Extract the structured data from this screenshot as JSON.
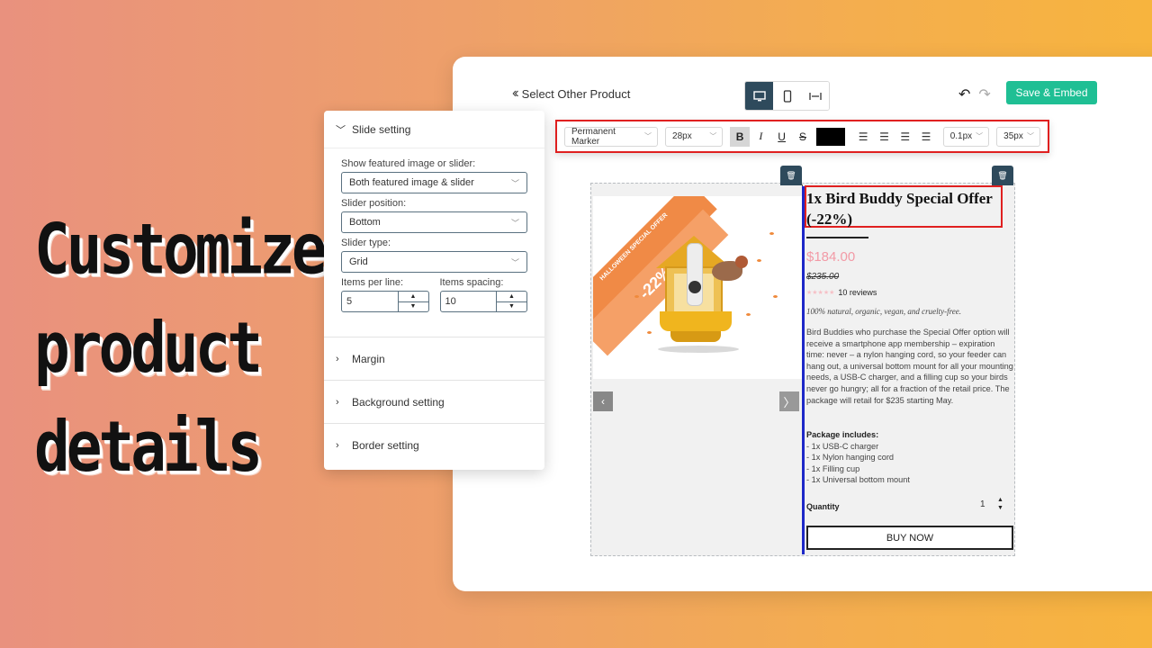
{
  "headline": [
    "Customize",
    "product",
    "details"
  ],
  "header": {
    "back_label": "Select Other Product",
    "save_label": "Save & Embed",
    "devices": [
      "desktop-icon",
      "mobile-icon",
      "fullwidth-icon"
    ]
  },
  "toolbar": {
    "font_family": "Permanent Marker",
    "font_size": "28px",
    "bold": "B",
    "italic": "I",
    "underline": "U",
    "strike": "S",
    "text_color": "#000000",
    "letter_spacing": "0.1px",
    "line_height": "35px"
  },
  "panel": {
    "slide_title": "Slide setting",
    "featured_label": "Show featured image or slider:",
    "featured_value": "Both featured image & slider",
    "position_label": "Slider position:",
    "position_value": "Bottom",
    "type_label": "Slider type:",
    "type_value": "Grid",
    "items_label": "Items per line:",
    "items_value": "5",
    "spacing_label": "Items spacing:",
    "spacing_value": "10",
    "margin_title": "Margin",
    "background_title": "Background setting",
    "border_title": "Border setting"
  },
  "product": {
    "title": "1x Bird Buddy Special Offer (-22%)",
    "image_ribbon": "HALLOWEEN SPECIAL OFFER",
    "image_discount": "-22%",
    "price": "$184.00",
    "old_price": "$235.00",
    "rating": 0,
    "reviews": "10 reviews",
    "tagline": "100% natural, organic, vegan, and cruelty-free.",
    "description": "Bird Buddies who purchase the Special Offer option will receive a smartphone app membership – expiration time: never –  a nylon hanging cord, so your feeder can hang out, a universal bottom mount for all your mounting needs, a USB-C charger, and a filling cup so your birds never go hungry; all for a fraction of the retail price. The package will retail for $235 starting May.",
    "package_title": "Package includes:",
    "package_items": [
      "- 1x USB-C charger",
      "- 1x Nylon hanging cord",
      "- 1x Filling cup",
      "- 1x Universal bottom mount"
    ],
    "quantity_label": "Quantity",
    "quantity_value": "1",
    "buy_label": "BUY NOW"
  },
  "colors": {
    "accent": "#1fbf94",
    "dark": "#2e4a5c",
    "highlight": "#e02020",
    "price": "#f29aa6"
  }
}
